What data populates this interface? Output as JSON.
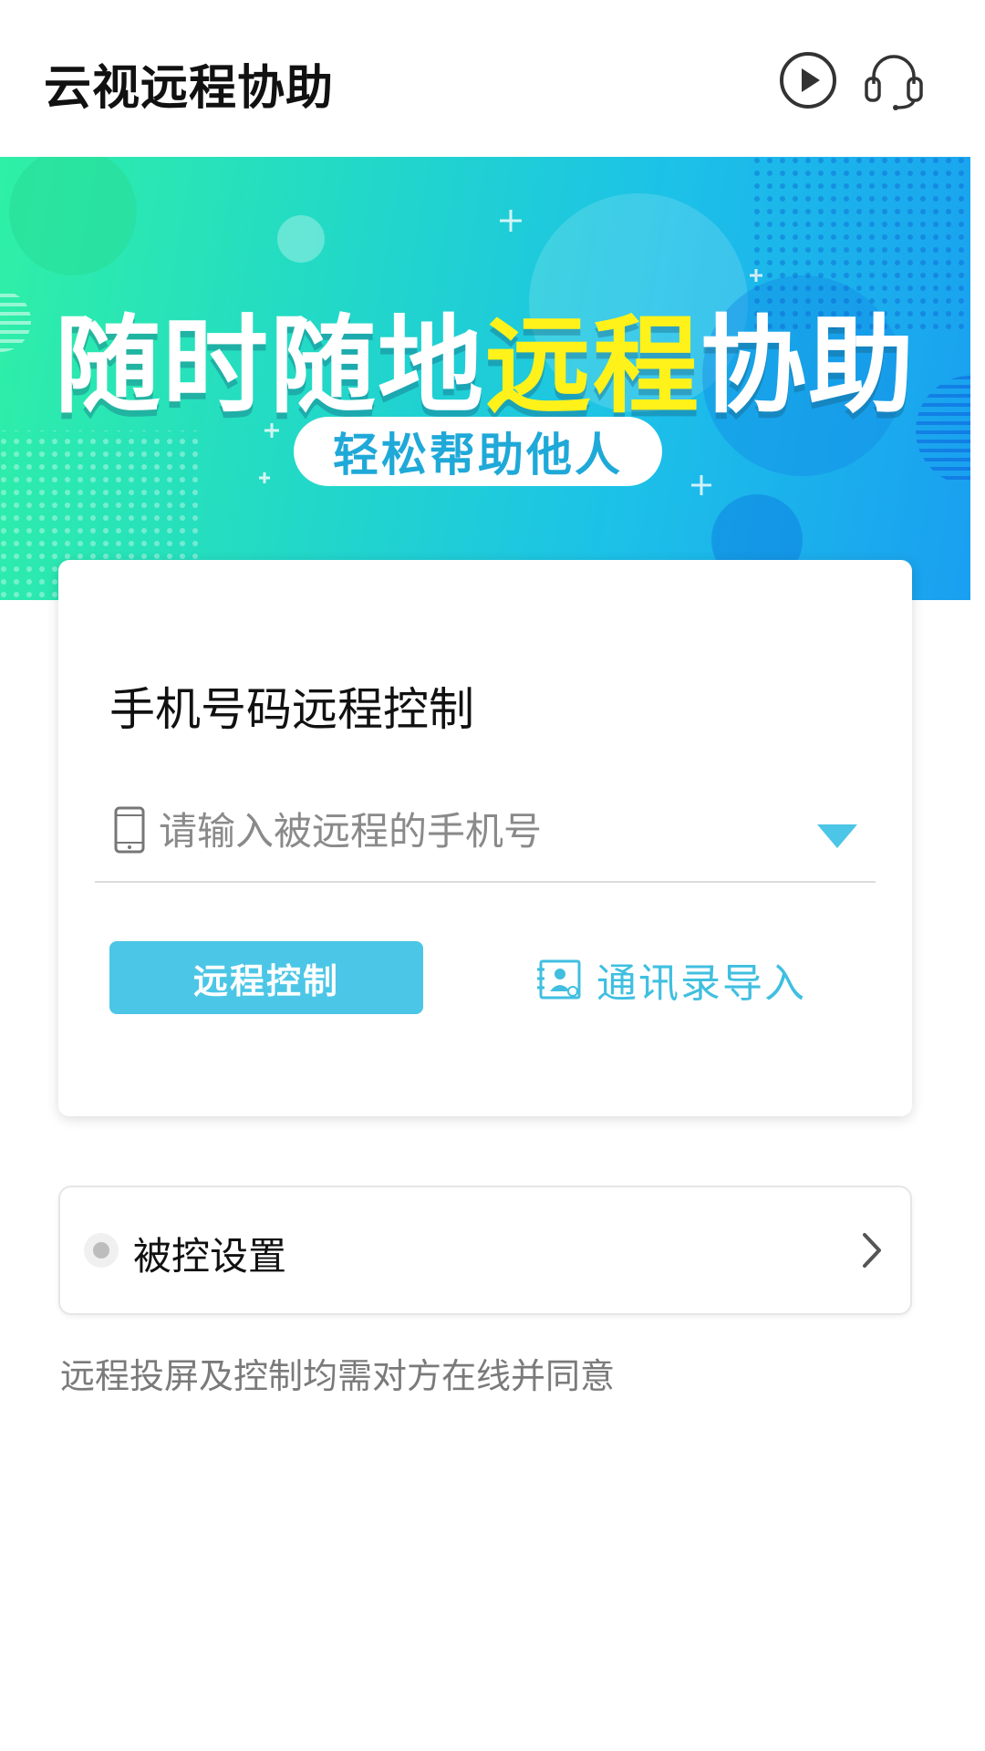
{
  "header": {
    "app_title": "云视远程协助",
    "play_icon": "play-circle-icon",
    "headset_icon": "headset-icon"
  },
  "banner": {
    "title_part1": "随时随地",
    "title_highlight": "远程",
    "title_part2": "协助",
    "subtitle": "轻松帮助他人",
    "colors": {
      "gradient_start": "#2ff0a6",
      "gradient_end": "#1a9ff0",
      "highlight": "#fff21a"
    }
  },
  "control_card": {
    "title": "手机号码远程控制",
    "phone_input": {
      "placeholder": "请输入被远程的手机号",
      "value": ""
    },
    "remote_button_label": "远程控制",
    "contacts_import_label": "通讯录导入",
    "accent_color": "#4cc6e6"
  },
  "settings": {
    "label": "被控设置"
  },
  "notice_text": "远程投屏及控制均需对方在线并同意"
}
